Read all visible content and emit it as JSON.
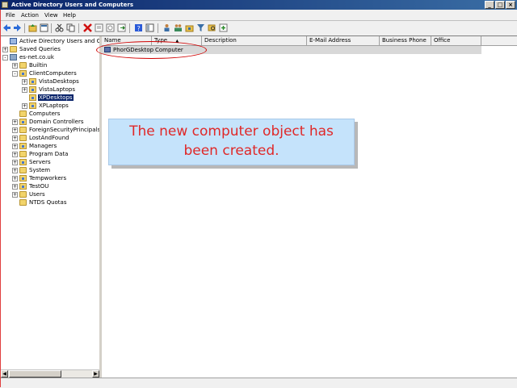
{
  "window": {
    "title": "Active Directory Users and Computers"
  },
  "menu": [
    "File",
    "Action",
    "View",
    "Help"
  ],
  "toolbar_icons": [
    "back-icon",
    "forward-icon",
    "up-folder-icon",
    "properties-icon",
    "cut-icon",
    "copy-icon",
    "delete-icon",
    "export-icon",
    "refresh-icon",
    "export-list-icon",
    "help-icon",
    "view-icon",
    "users-icon",
    "group-icon",
    "ou-icon",
    "filter-icon",
    "find-icon",
    "add-to-group-icon"
  ],
  "tree": [
    {
      "label": "Active Directory Users and Comput",
      "expander": "",
      "icon": "root"
    },
    {
      "label": "Saved Queries",
      "expander": "+",
      "icon": "folder"
    },
    {
      "label": "es-net.co.uk",
      "expander": "-",
      "icon": "domain"
    },
    {
      "label": "Builtin",
      "expander": "+",
      "icon": "folder"
    },
    {
      "label": "ClientComputers",
      "expander": "-",
      "icon": "ou"
    },
    {
      "label": "VistaDesktops",
      "expander": "+",
      "icon": "ou"
    },
    {
      "label": "VistaLaptops",
      "expander": "+",
      "icon": "ou"
    },
    {
      "label": "XPDesktops",
      "expander": "",
      "icon": "ou",
      "selected": true
    },
    {
      "label": "XPLaptops",
      "expander": "+",
      "icon": "ou"
    },
    {
      "label": "Computers",
      "expander": "",
      "icon": "folder"
    },
    {
      "label": "Domain Controllers",
      "expander": "+",
      "icon": "ou"
    },
    {
      "label": "ForeignSecurityPrincipals",
      "expander": "+",
      "icon": "folder"
    },
    {
      "label": "LostAndFound",
      "expander": "+",
      "icon": "folder"
    },
    {
      "label": "Managers",
      "expander": "+",
      "icon": "ou"
    },
    {
      "label": "Program Data",
      "expander": "+",
      "icon": "folder"
    },
    {
      "label": "Servers",
      "expander": "+",
      "icon": "ou"
    },
    {
      "label": "System",
      "expander": "+",
      "icon": "folder"
    },
    {
      "label": "Tempworkers",
      "expander": "+",
      "icon": "ou"
    },
    {
      "label": "TestOU",
      "expander": "+",
      "icon": "ou"
    },
    {
      "label": "Users",
      "expander": "+",
      "icon": "folder"
    },
    {
      "label": "NTDS Quotas",
      "expander": "",
      "icon": "folder"
    }
  ],
  "list": {
    "columns": [
      "Name",
      "Type",
      "Description",
      "E-Mail Address",
      "Business Phone",
      "Office"
    ],
    "sort_indicator": "▲",
    "rows": [
      {
        "name": "PhorGDesktop",
        "type": "Computer"
      }
    ]
  },
  "callout": {
    "line1": "The new computer object has",
    "line2": "been created."
  },
  "colors": {
    "callout_bg": "#c5e3fb",
    "callout_text": "#e02828",
    "highlight_circle": "#d00000",
    "selection": "#0a246a"
  }
}
